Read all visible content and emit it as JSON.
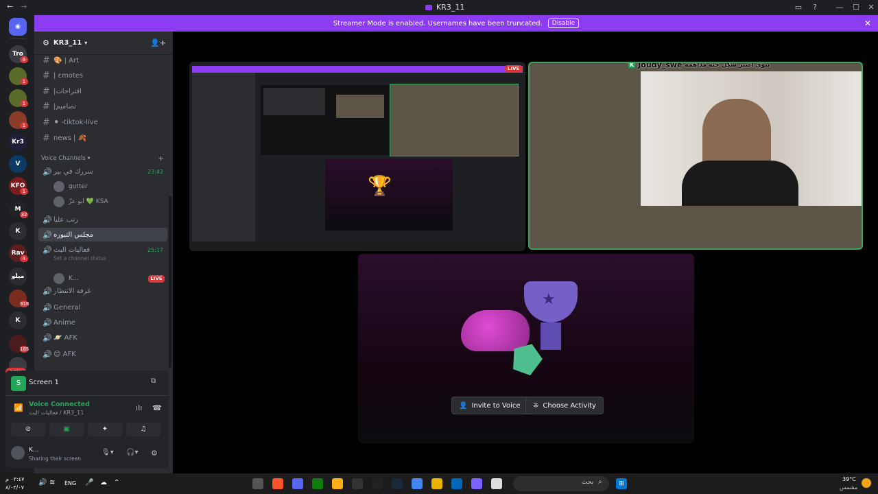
{
  "window": {
    "title": "KR3_11"
  },
  "banner": {
    "text": "Streamer Mode is enabled. Usernames have been truncated.",
    "disable_label": "Disable"
  },
  "guilds": [
    {
      "label": "Tro",
      "badge": "8"
    },
    {
      "label": "",
      "badge": "1"
    },
    {
      "label": "",
      "badge": "1"
    },
    {
      "label": "",
      "badge": "1"
    },
    {
      "label": "Kr3"
    },
    {
      "label": "V"
    },
    {
      "label": "KFO",
      "badge": "1"
    },
    {
      "label": "M",
      "badge": "32"
    },
    {
      "label": "K"
    },
    {
      "label": "Rav",
      "badge": "4"
    },
    {
      "label": "ميلو"
    },
    {
      "label": "",
      "badge": "318"
    },
    {
      "label": "K"
    },
    {
      "label": "",
      "badge": "185"
    },
    {
      "label": "",
      "badge": "NEW"
    }
  ],
  "server": {
    "name": "KR3_11"
  },
  "text_channels": [
    {
      "name": "🎨 | Art"
    },
    {
      "name": "| ɛmotes"
    },
    {
      "name": "|اقتراحات"
    },
    {
      "name": "|تصاميم"
    },
    {
      "name": "⚫ -tiktok-live"
    },
    {
      "name": "news | 🍂"
    }
  ],
  "voice_header": "Voice Channels",
  "voice_channels": [
    {
      "name": "سررك في بير",
      "time": "23:42",
      "users": [
        "gutter",
        "ابو عزّ 💚 KSA"
      ]
    },
    {
      "name": "رتب عليا"
    },
    {
      "name": "مجلس التبوره"
    },
    {
      "name": "فعاليات البث",
      "time": "25:17",
      "status": "Set a channel status",
      "users": [
        "K..."
      ],
      "live": "LIVE"
    },
    {
      "name": "غرفة الانتظار"
    },
    {
      "name": "General"
    },
    {
      "name": "Anime"
    },
    {
      "name": "🪐 AFK"
    },
    {
      "name": "😊 AFK"
    }
  ],
  "panel": {
    "screen_label": "Screen 1",
    "voice_connected": "Voice Connected",
    "voice_sub": "فعاليات البث / KR3_11",
    "user_name": "K...",
    "user_status": "Sharing their screen"
  },
  "stream": {
    "live": "LIVE"
  },
  "camera": {
    "name": "Joudy_swe",
    "caption": "بيوي اصير شكل جته مداهمه"
  },
  "activity": {
    "invite_label": "Invite to Voice",
    "choose_label": "Choose Activity"
  },
  "taskbar": {
    "time": "٠٣:٤٧ م",
    "date": "٨/٠٣/٠٧",
    "lang": "ENG",
    "search_placeholder": "بحث",
    "weather_temp": "39°C",
    "weather_label": "مشمس"
  },
  "colors": {
    "accent": "#8c3cf0",
    "live": "#da373c",
    "connected": "#23a55a",
    "speaking": "#3ba55d"
  }
}
